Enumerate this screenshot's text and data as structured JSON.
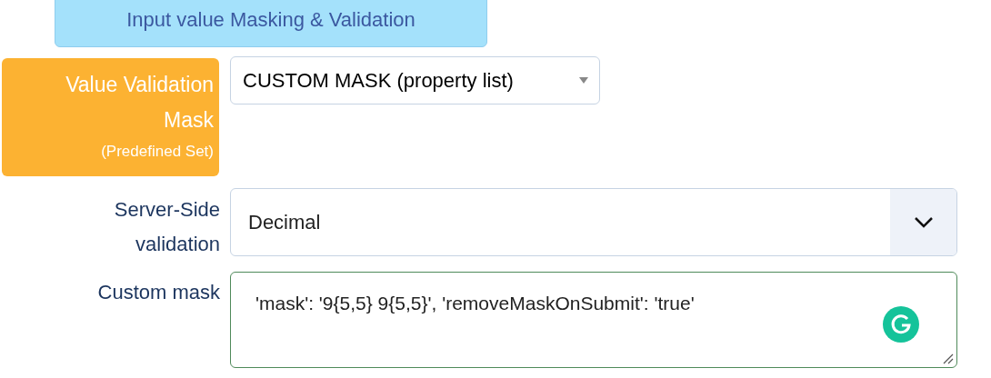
{
  "header": {
    "title": "Input value Masking & Validation"
  },
  "mask_set": {
    "label": "Value Validation Mask",
    "note": "(Predefined Set)",
    "value": "CUSTOM MASK (property list)"
  },
  "server_validation": {
    "label": "Server-Side validation",
    "value": "Decimal"
  },
  "custom_mask": {
    "label": "Custom mask",
    "value": "'mask': '9{5,5} 9{5,5}', 'removeMaskOnSubmit': 'true'"
  }
}
